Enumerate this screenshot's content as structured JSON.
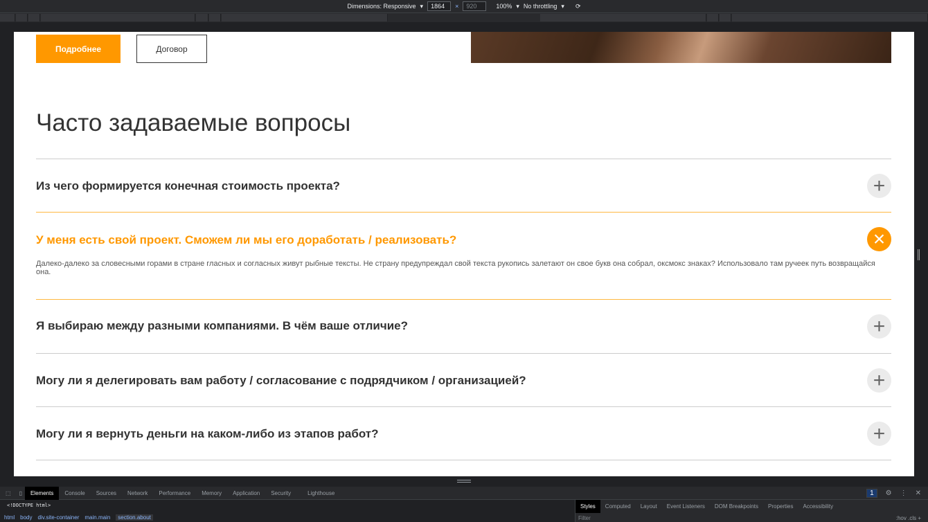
{
  "toolbar": {
    "dimensions": "Dimensions: Responsive",
    "width": "1864",
    "height": "920",
    "times": "×",
    "zoom": "100%",
    "throttling": "No throttling"
  },
  "page": {
    "buttons": {
      "more": "Подробнее",
      "contract": "Договор"
    },
    "faq_title": "Часто задаваемые вопросы",
    "faq": [
      {
        "q": "Из чего формируется конечная стоимость проекта?",
        "open": false
      },
      {
        "q": "У меня есть свой проект. Сможем ли мы его доработать / реализовать?",
        "open": true,
        "a": "Далеко-далеко за словесными горами в стране гласных и согласных живут рыбные тексты. Не страну предупреждал свой текста рукопись залетают он свое букв она собрал, оксмокс знаках? Использовало там ручеек путь возвращайся она."
      },
      {
        "q": "Я выбираю между разными компаниями. В чём ваше отличие?",
        "open": false
      },
      {
        "q": "Могу ли я делегировать вам работу / согласование с подрядчиком / организацией?",
        "open": false
      },
      {
        "q": "Могу ли я вернуть деньги на каком-либо из этапов работ?",
        "open": false
      }
    ]
  },
  "devtools": {
    "tabs": [
      "Elements",
      "Console",
      "Sources",
      "Network",
      "Performance",
      "Memory",
      "Application",
      "Security",
      "Lighthouse"
    ],
    "issues": "1",
    "doctype": "<!DOCTYPE html>",
    "breadcrumbs": [
      "html",
      "body",
      "div.site-container",
      "main.main",
      "section.about"
    ],
    "styles_tabs": [
      "Styles",
      "Computed",
      "Layout",
      "Event Listeners",
      "DOM Breakpoints",
      "Properties",
      "Accessibility"
    ],
    "filter": "Filter",
    "filter_right": ":hov  .cls  +"
  }
}
